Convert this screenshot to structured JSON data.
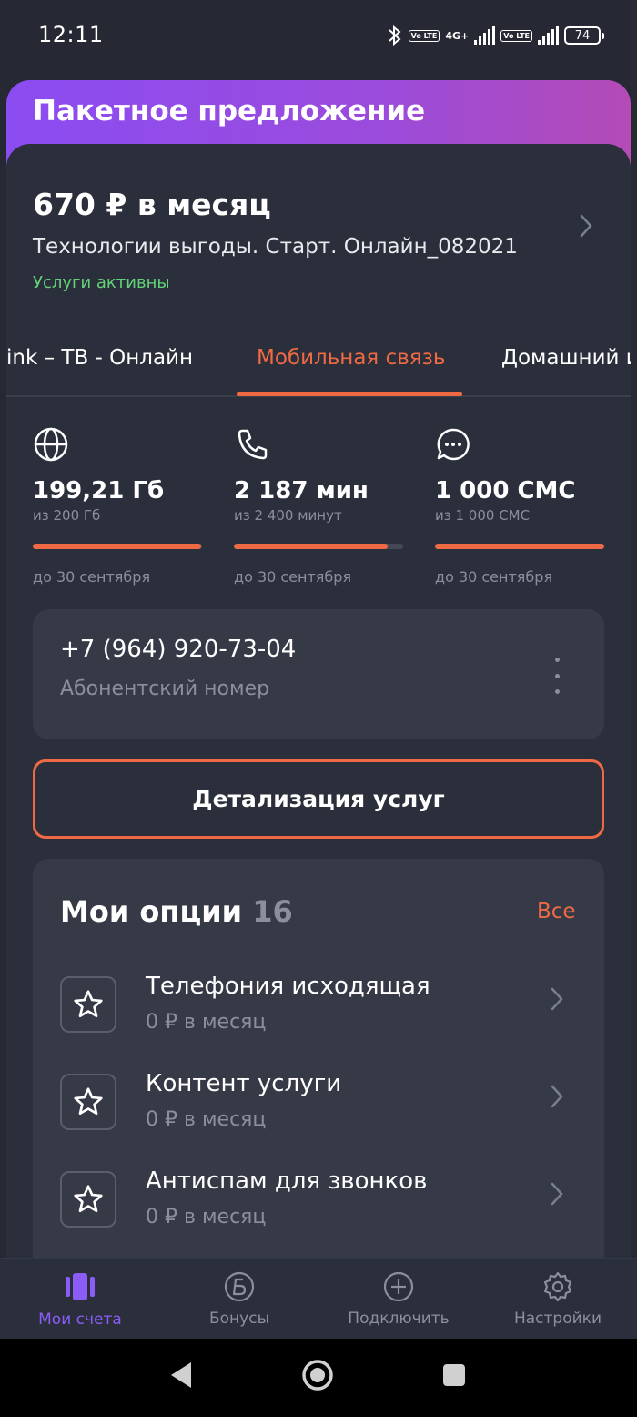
{
  "status_bar": {
    "time": "12:11",
    "volte1": "Vo LTE",
    "network": "4G+",
    "volte2": "Vo LTE",
    "battery": "74"
  },
  "offer": {
    "title": "Пакетное предложение",
    "price": "670 ₽ в месяц",
    "tariff": "Технологии выгоды. Старт. Онлайн_082021",
    "status": "Услуги активны"
  },
  "tabs": [
    {
      "label": "ink – ТВ - Онлайн",
      "active": false
    },
    {
      "label": "Мобильная связь",
      "active": true
    },
    {
      "label": "Домашний и",
      "active": false
    }
  ],
  "counters": [
    {
      "icon": "globe-icon",
      "value": "199,21 Гб",
      "sub": "из 200 Гб",
      "progress": 0.996,
      "until": "до 30 сентября"
    },
    {
      "icon": "phone-icon",
      "value": "2 187 мин",
      "sub": "из 2 400 минут",
      "progress": 0.911,
      "until": "до 30 сентября"
    },
    {
      "icon": "chat-icon",
      "value": "1 000 СМС",
      "sub": "из 1 000 СМС",
      "progress": 1.0,
      "until": "до 30 сентября"
    }
  ],
  "phone": {
    "number": "+7 (964) 920-73-04",
    "label": "Абонентский номер"
  },
  "details_button": "Детализация услуг",
  "options": {
    "title": "Мои опции",
    "count": "16",
    "all_link": "Все",
    "items": [
      {
        "name": "Телефония исходящая",
        "price": "0 ₽ в месяц"
      },
      {
        "name": "Контент услуги",
        "price": "0 ₽ в месяц"
      },
      {
        "name": "Антиспам для звонков",
        "price": "0 ₽ в месяц"
      }
    ]
  },
  "bottom_nav": [
    {
      "label": "Мои счета",
      "icon": "accounts-icon",
      "active": true
    },
    {
      "label": "Бонусы",
      "icon": "bonus-icon",
      "active": false
    },
    {
      "label": "Подключить",
      "icon": "plus-circle-icon",
      "active": false
    },
    {
      "label": "Настройки",
      "icon": "gear-icon",
      "active": false
    }
  ],
  "colors": {
    "accent": "#ef6a44",
    "nav_active": "#8b5cf6",
    "success": "#63d37a",
    "background": "#262933"
  }
}
